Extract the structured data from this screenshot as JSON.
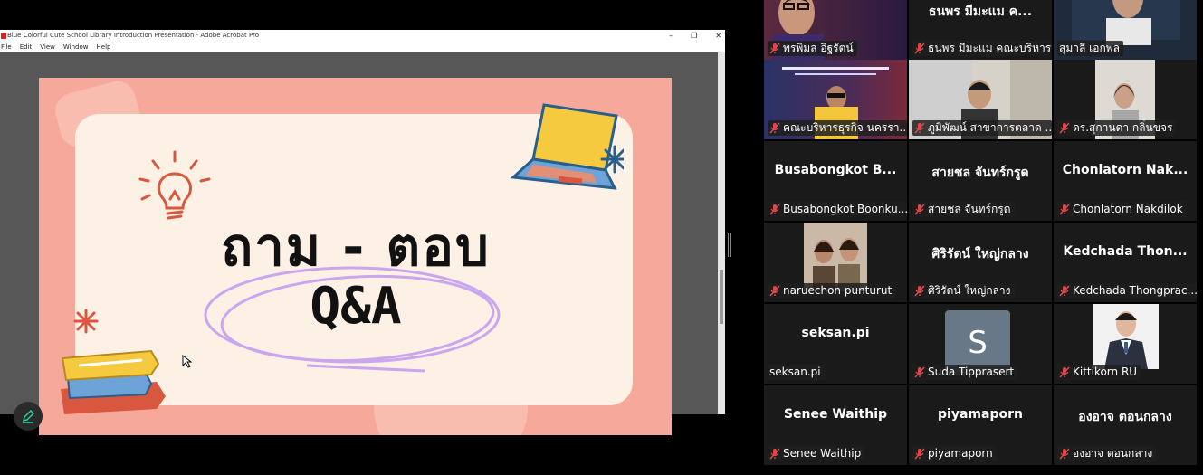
{
  "share": {
    "window_title": "Blue Colorful Cute School Library Introduction Presentation - Adobe Acrobat Pro",
    "menu": [
      "File",
      "Edit",
      "View",
      "Window",
      "Help"
    ],
    "window_controls": [
      "–",
      "❐",
      "✕"
    ]
  },
  "slide": {
    "title_thai": "ถาม - ตอบ",
    "title_qa": "Q&A",
    "colors": {
      "background": "#f6a99a",
      "card": "#fdf1e6",
      "accent_circle": "#c9a6ee"
    }
  },
  "participants": [
    {
      "label": "พรพิมล อิฐรัตน์",
      "muted": true,
      "video": true
    },
    {
      "name": "ธนพร มีมะแม ค...",
      "label": "ธนพร มีมะแม คณะบริหาร...",
      "muted": true,
      "video": false
    },
    {
      "label": "สุมาลี  เอกพล",
      "muted": false,
      "video": true,
      "active": true
    },
    {
      "label": "คณะบริหารธุรกิจ นครรา...",
      "muted": true,
      "video": true
    },
    {
      "label": "ภูมิพัฒน์ สาขาการตลาด ...",
      "muted": true,
      "video": true
    },
    {
      "label": "ดร.สุกานดา กลิ่นขจร",
      "muted": true,
      "video": true
    },
    {
      "name": "Busabongkot  B...",
      "label": "Busabongkot Boonku...",
      "muted": true,
      "video": false
    },
    {
      "name": "สายชล จันทร์กรูด",
      "label": "สายชล จันทร์กรูด",
      "muted": true,
      "video": false
    },
    {
      "name": "Chonlatorn  Nak...",
      "label": "Chonlatorn Nakdilok",
      "muted": true,
      "video": false
    },
    {
      "label": "naruechon punturut",
      "muted": true,
      "video": true
    },
    {
      "name": "ศิริรัตน์  ใหญ่กลาง",
      "label": "ศิริรัตน์  ใหญ่กลาง",
      "muted": true,
      "video": false
    },
    {
      "name": "Kedchada  Thon...",
      "label": "Kedchada Thongprac...",
      "muted": true,
      "video": false
    },
    {
      "name": "seksan.pi",
      "label": "seksan.pi",
      "muted": false,
      "video": false
    },
    {
      "avatar": "S",
      "label": "Suda Tipprasert",
      "muted": true,
      "video": false
    },
    {
      "label": "Kittikorn RU",
      "muted": true,
      "video": true
    },
    {
      "name": "Senee Waithip",
      "label": "Senee Waithip",
      "muted": true,
      "video": false
    },
    {
      "name": "piyamaporn",
      "label": "piyamaporn",
      "muted": true,
      "video": false
    },
    {
      "name": "องอาจ ตอนกลาง",
      "label": "องอาจ ตอนกลาง",
      "muted": true,
      "video": false
    }
  ],
  "colors": {
    "active_border": "#26c6a4",
    "mic_muted": "#e0474c",
    "tile_bg": "#1a1a1a"
  }
}
